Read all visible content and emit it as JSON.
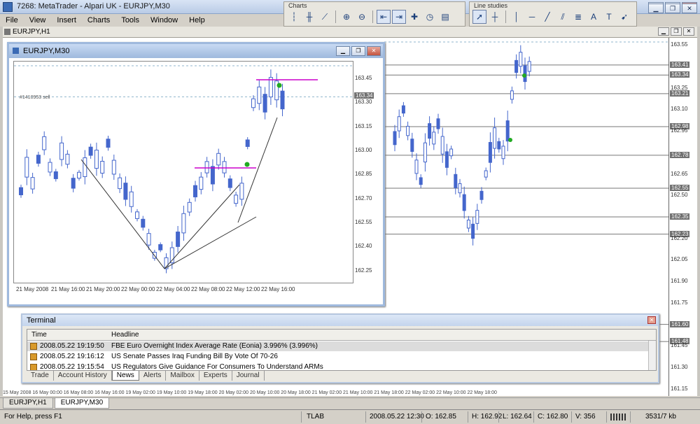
{
  "app": {
    "title": "7268: MetaTrader - Alpari UK - EURJPY,M30"
  },
  "menu": [
    "File",
    "View",
    "Insert",
    "Charts",
    "Tools",
    "Window",
    "Help"
  ],
  "toolbars": {
    "charts": {
      "title": "Charts"
    },
    "line_studies": {
      "title": "Line studies"
    }
  },
  "mdi": {
    "active_doc": "EURJPY,H1"
  },
  "big_chart": {
    "price_labels": [
      "163.55",
      "163.41",
      "163.34",
      "163.25",
      "163.21",
      "163.10",
      "162.98",
      "162.95",
      "162.78",
      "162.65",
      "162.55",
      "162.50",
      "162.35",
      "162.23",
      "162.20",
      "162.05",
      "161.90",
      "161.75",
      "161.60",
      "161.48",
      "161.45",
      "161.30",
      "161.15"
    ],
    "boxed_labels": [
      "163.41",
      "163.34",
      "163.21",
      "162.98",
      "162.78",
      "162.55",
      "162.35",
      "162.23",
      "161.60",
      "161.48"
    ],
    "date_axis": "15 May 2008  16 May 00:00  16 May 08:00  16 May 16:00  19 May 02:00  19 May 10:00  19 May 18:00  20 May 02:00  20 May 10:00  20 May 18:00  21 May 02:00  21 May 10:00  21 May 18:00  22 May 02:00  22 May 10:00  22 May 18:00"
  },
  "chart_window": {
    "title": "EURJPY,M30",
    "order_label": "#1410953 sell",
    "price_labels": [
      "163.45",
      "163.34",
      "163.30",
      "163.15",
      "163.00",
      "162.85",
      "162.70",
      "162.55",
      "162.40",
      "162.25"
    ],
    "current_price": "163.34",
    "date_labels": [
      "21 May 2008",
      "21 May 16:00",
      "21 May 20:00",
      "22 May 00:00",
      "22 May 04:00",
      "22 May 08:00",
      "22 May 12:00",
      "22 May 16:00"
    ]
  },
  "terminal": {
    "title": "Terminal",
    "columns": [
      "Time",
      "Headline"
    ],
    "rows": [
      {
        "time": "2008.05.22 19:19:50",
        "headline": "FBE Euro Overnight Index Average Rate (Eonia) 3.996% (3.996%)"
      },
      {
        "time": "2008.05.22 19:16:12",
        "headline": "US Senate Passes Iraq Funding Bill By Vote Of 70-26"
      },
      {
        "time": "2008.05.22 19:15:54",
        "headline": "US Regulators Give Guidance For Consumers To Understand ARMs"
      }
    ],
    "tabs": [
      "Trade",
      "Account History",
      "News",
      "Alerts",
      "Mailbox",
      "Experts",
      "Journal"
    ],
    "active_tab": "News"
  },
  "chart_tabs": [
    "EURJPY,H1",
    "EURJPY,M30"
  ],
  "active_chart_tab": "EURJPY,M30",
  "status": {
    "help": "For Help, press F1",
    "template": "TLAB",
    "time": "2008.05.22 12:30",
    "open": "O: 162.85",
    "high": "H: 162.92",
    "low": "L: 162.64",
    "close": "C: 162.80",
    "volume": "V: 356",
    "traffic": "3531/7 kb"
  },
  "colors": {
    "candle": "#4466cc",
    "ma_line": "#cc00cc",
    "order_line": "#66aacc"
  }
}
